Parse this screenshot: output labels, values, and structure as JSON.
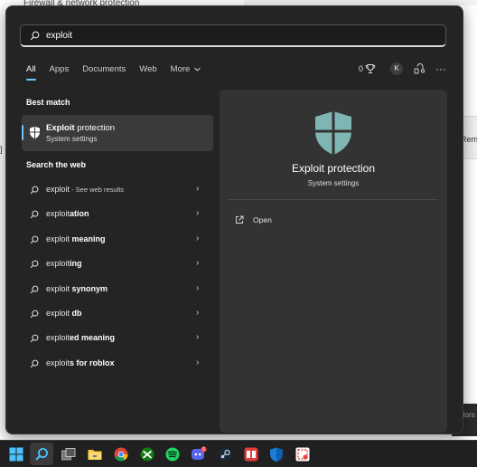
{
  "background": {
    "window_title": "Firewall & network protection",
    "right_text": "Rem",
    "left_text": "]",
    "dark_text": "utors"
  },
  "search": {
    "value": "exploit"
  },
  "tabs": [
    {
      "label": "All"
    },
    {
      "label": "Apps"
    },
    {
      "label": "Documents"
    },
    {
      "label": "Web"
    },
    {
      "label": "More"
    }
  ],
  "header_right": {
    "rewards_count": "0",
    "avatar_letter": "K"
  },
  "best_match": {
    "heading": "Best match",
    "title_bold": "Exploit",
    "title_rest": " protection",
    "subtitle": "System settings"
  },
  "web": {
    "heading": "Search the web",
    "items": [
      {
        "pre": "exploit",
        "bold": "",
        "see": " - See web results"
      },
      {
        "pre": "exploit",
        "bold": "ation",
        "see": ""
      },
      {
        "pre": "exploit",
        "bold": " meaning",
        "see": ""
      },
      {
        "pre": "exploit",
        "bold": "ing",
        "see": ""
      },
      {
        "pre": "exploit",
        "bold": " synonym",
        "see": ""
      },
      {
        "pre": "exploit",
        "bold": " db",
        "see": ""
      },
      {
        "pre": "exploit",
        "bold": "ed meaning",
        "see": ""
      },
      {
        "pre": "exploit",
        "bold": "s for roblox",
        "see": ""
      }
    ]
  },
  "preview": {
    "title": "Exploit protection",
    "subtitle": "System settings",
    "open_label": "Open"
  },
  "colors": {
    "accent": "#6cc6ff",
    "panel": "#242424",
    "shield": "#7fb6b3"
  },
  "taskbar": {
    "icons": [
      "start-icon",
      "search-icon",
      "task-view-icon",
      "file-explorer-icon",
      "chrome-icon",
      "xbox-icon",
      "spotify-icon",
      "discord-icon",
      "steam-icon",
      "app-icon",
      "defender-icon",
      "snipping-icon"
    ],
    "discord_badge": "6"
  }
}
